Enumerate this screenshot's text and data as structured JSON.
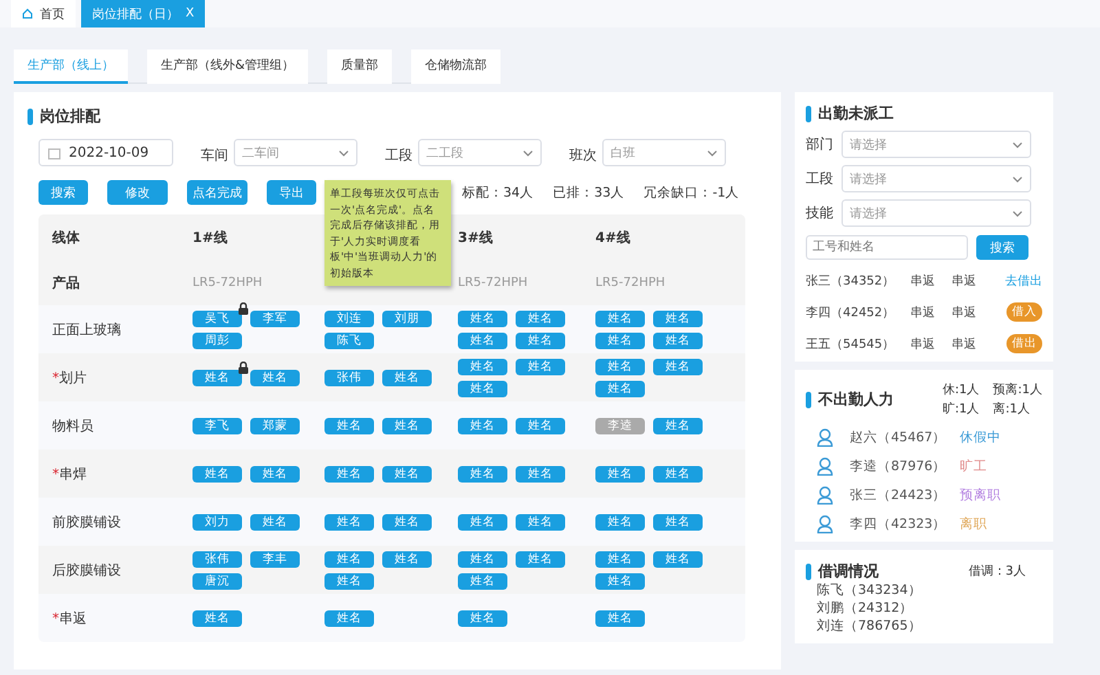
{
  "page_tabs": [
    {
      "label": "首页",
      "kind": "home",
      "selected": false
    },
    {
      "label": "岗位排配（日）",
      "close": "X",
      "kind": "page",
      "selected": true
    }
  ],
  "dept_tabs": [
    {
      "label": "生产部（线上）",
      "selected": true
    },
    {
      "label": "生产部（线外&管理组）",
      "selected": false
    },
    {
      "label": "质量部",
      "selected": false
    },
    {
      "label": "仓储物流部",
      "selected": false
    }
  ],
  "schedule": {
    "title": "岗位排配",
    "date": "2022-10-09",
    "filters": [
      {
        "label": "车间",
        "value": "二车间"
      },
      {
        "label": "工段",
        "value": "二工段"
      },
      {
        "label": "班次",
        "value": "白班"
      }
    ],
    "buttons": [
      "搜索",
      "修改",
      "点名完成",
      "导出"
    ],
    "stats": [
      "标配：34人",
      "已排：33人",
      "冗余缺口：-1人"
    ],
    "tooltip": "单工段每班次仅可点击一次'点名完成'。点名完成后存储该排配，用于'人力实时调度看板'中'当班调动人力'的初始版本",
    "table": {
      "header_label": "线体",
      "product_label": "产品",
      "columns": [
        {
          "kind": "line",
          "line": "1#线",
          "product": "LR5-72HPH"
        },
        {
          "kind": "hidden"
        },
        {
          "kind": "line",
          "line": "3#线",
          "product": "LR5-72HPH"
        },
        {
          "kind": "line",
          "line": "4#线",
          "product": "LR5-72HPH"
        }
      ],
      "rows": [
        {
          "station": "正面上玻璃",
          "cells": [
            [
              {
                "name": "吴飞",
                "locked": true,
                "inactive": false
              },
              {
                "name": "李军",
                "locked": false,
                "inactive": false
              },
              {
                "name": "周彭",
                "locked": false,
                "inactive": false
              }
            ],
            [
              {
                "name": "刘连",
                "locked": false,
                "inactive": false
              },
              {
                "name": "刘朋",
                "locked": false,
                "inactive": false
              },
              {
                "name": "陈飞",
                "locked": false,
                "inactive": false
              }
            ],
            [
              {
                "name": "姓名",
                "locked": false,
                "inactive": false
              },
              {
                "name": "姓名",
                "locked": false,
                "inactive": false
              },
              {
                "name": "姓名",
                "locked": false,
                "inactive": false
              },
              {
                "name": "姓名",
                "locked": false,
                "inactive": false
              }
            ],
            [
              {
                "name": "姓名",
                "locked": false,
                "inactive": false
              },
              {
                "name": "姓名",
                "locked": false,
                "inactive": false
              },
              {
                "name": "姓名",
                "locked": false,
                "inactive": false
              },
              {
                "name": "姓名",
                "locked": false,
                "inactive": false
              }
            ]
          ]
        },
        {
          "station": "划片",
          "marker": "*",
          "cells": [
            [
              {
                "name": "姓名",
                "locked": true,
                "inactive": false
              },
              {
                "name": "姓名",
                "locked": false,
                "inactive": false
              }
            ],
            [
              {
                "name": "张伟",
                "locked": false,
                "inactive": false
              },
              {
                "name": "姓名",
                "locked": false,
                "inactive": false
              }
            ],
            [
              {
                "name": "姓名",
                "locked": false,
                "inactive": false
              },
              {
                "name": "姓名",
                "locked": false,
                "inactive": false
              },
              {
                "name": "姓名",
                "locked": false,
                "inactive": false
              }
            ],
            [
              {
                "name": "姓名",
                "locked": false,
                "inactive": false
              },
              {
                "name": "姓名",
                "locked": false,
                "inactive": false
              },
              {
                "name": "姓名",
                "locked": false,
                "inactive": false
              }
            ]
          ]
        },
        {
          "station": "物料员",
          "cells": [
            [
              {
                "name": "李飞",
                "locked": false,
                "inactive": false
              },
              {
                "name": "郑蒙",
                "locked": false,
                "inactive": false
              }
            ],
            [
              {
                "name": "姓名",
                "locked": false,
                "inactive": false
              },
              {
                "name": "姓名",
                "locked": false,
                "inactive": false
              }
            ],
            [
              {
                "name": "姓名",
                "locked": false,
                "inactive": false
              },
              {
                "name": "姓名",
                "locked": false,
                "inactive": false
              }
            ],
            [
              {
                "name": "李逵",
                "locked": false,
                "inactive": true
              },
              {
                "name": "姓名",
                "locked": false,
                "inactive": false
              }
            ]
          ]
        },
        {
          "station": "串焊",
          "marker": "*",
          "cells": [
            [
              {
                "name": "姓名",
                "locked": false,
                "inactive": false
              },
              {
                "name": "姓名",
                "locked": false,
                "inactive": false
              }
            ],
            [
              {
                "name": "姓名",
                "locked": false,
                "inactive": false
              },
              {
                "name": "姓名",
                "locked": false,
                "inactive": false
              }
            ],
            [
              {
                "name": "姓名",
                "locked": false,
                "inactive": false
              },
              {
                "name": "姓名",
                "locked": false,
                "inactive": false
              }
            ],
            [
              {
                "name": "姓名",
                "locked": false,
                "inactive": false
              },
              {
                "name": "姓名",
                "locked": false,
                "inactive": false
              }
            ]
          ]
        },
        {
          "station": "前胶膜铺设",
          "cells": [
            [
              {
                "name": "刘力",
                "locked": false,
                "inactive": false
              },
              {
                "name": "姓名",
                "locked": false,
                "inactive": false
              }
            ],
            [
              {
                "name": "姓名",
                "locked": false,
                "inactive": false
              },
              {
                "name": "姓名",
                "locked": false,
                "inactive": false
              }
            ],
            [
              {
                "name": "姓名",
                "locked": false,
                "inactive": false
              },
              {
                "name": "姓名",
                "locked": false,
                "inactive": false
              }
            ],
            [
              {
                "name": "姓名",
                "locked": false,
                "inactive": false
              },
              {
                "name": "姓名",
                "locked": false,
                "inactive": false
              }
            ]
          ]
        },
        {
          "station": "后胶膜铺设",
          "cells": [
            [
              {
                "name": "张伟",
                "locked": false,
                "inactive": false
              },
              {
                "name": "李丰",
                "locked": false,
                "inactive": false
              },
              {
                "name": "唐沉",
                "locked": false,
                "inactive": false
              }
            ],
            [
              {
                "name": "姓名",
                "locked": false,
                "inactive": false
              },
              {
                "name": "姓名",
                "locked": false,
                "inactive": false
              },
              {
                "name": "姓名",
                "locked": false,
                "inactive": false
              }
            ],
            [
              {
                "name": "姓名",
                "locked": false,
                "inactive": false
              },
              {
                "name": "姓名",
                "locked": false,
                "inactive": false
              },
              {
                "name": "姓名",
                "locked": false,
                "inactive": false
              }
            ],
            [
              {
                "name": "姓名",
                "locked": false,
                "inactive": false
              },
              {
                "name": "姓名",
                "locked": false,
                "inactive": false
              },
              {
                "name": "姓名",
                "locked": false,
                "inactive": false
              }
            ]
          ]
        },
        {
          "station": "串返",
          "marker": "*",
          "cells": [
            [
              {
                "name": "姓名",
                "locked": false,
                "inactive": false
              }
            ],
            [
              {
                "name": "姓名",
                "locked": false,
                "inactive": false
              }
            ],
            [
              {
                "name": "姓名",
                "locked": false,
                "inactive": false
              }
            ],
            [
              {
                "name": "姓名",
                "locked": false,
                "inactive": false
              }
            ]
          ]
        }
      ]
    }
  },
  "unassigned": {
    "title": "出勤未派工",
    "selects": [
      {
        "label": "部门",
        "placeholder": "请选择"
      },
      {
        "label": "工段",
        "placeholder": "请选择"
      },
      {
        "label": "技能",
        "placeholder": "请选择"
      }
    ],
    "search": {
      "placeholder": "工号和姓名",
      "button": "搜索"
    },
    "people": [
      {
        "name": "张三（34352）",
        "from": "串返",
        "to": "串返",
        "action": "去借出",
        "kind": "link"
      },
      {
        "name": "李四（42452）",
        "from": "串返",
        "to": "串返",
        "action": "借入",
        "kind": "badge"
      },
      {
        "name": "王五（54545）",
        "from": "串返",
        "to": "串返",
        "action": "借出",
        "kind": "badge"
      }
    ]
  },
  "absent": {
    "title": "不出勤人力",
    "counts": [
      "休:1人",
      "预离:1人",
      "旷:1人",
      "离:1人"
    ],
    "people": [
      {
        "name": "赵六（45467）",
        "status": "休假中",
        "color": "#3a9ad6"
      },
      {
        "name": "李逵（87976）",
        "status": "旷工",
        "color": "#e08a8a"
      },
      {
        "name": "张三（24423）",
        "status": "预离职",
        "color": "#b27fe0"
      },
      {
        "name": "李四（42323）",
        "status": "离职",
        "color": "#e0a85a"
      }
    ]
  },
  "loans": {
    "title": "借调情况",
    "count": "借调：3人",
    "people": [
      "陈飞（343234）",
      "刘鹏（24312）",
      "刘连（786765）"
    ]
  }
}
